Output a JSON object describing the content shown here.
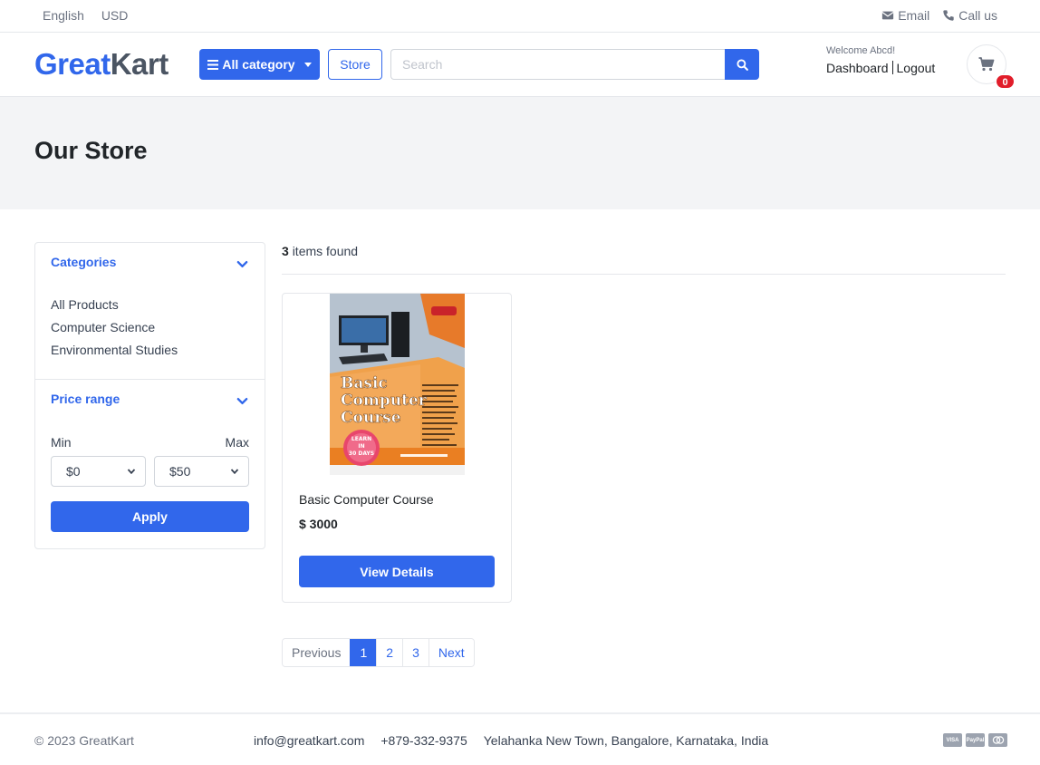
{
  "topbar": {
    "language": "English",
    "currency": "USD",
    "email_label": "Email",
    "call_label": "Call us"
  },
  "header": {
    "logo_part1": "Great",
    "logo_part2": "Kart",
    "category_button": "All category",
    "store_button": "Store",
    "search_placeholder": "Search",
    "welcome_text": "Welcome Abcd!",
    "dashboard_link": "Dashboard",
    "logout_link": "Logout",
    "cart_count": "0"
  },
  "page": {
    "title": "Our Store"
  },
  "sidebar": {
    "categories_title": "Categories",
    "categories": [
      "All Products",
      "Computer Science",
      "Environmental Studies"
    ],
    "price_title": "Price range",
    "min_label": "Min",
    "max_label": "Max",
    "min_value": "$0",
    "max_value": "$50",
    "apply_button": "Apply"
  },
  "results": {
    "count": "3",
    "count_suffix": "items found",
    "products": [
      {
        "name": "Basic Computer Course",
        "price": "$ 3000",
        "button": "View Details",
        "cover_title_lines": [
          "Basic",
          "Computer",
          "Course"
        ],
        "cover_badge_lines": [
          "LEARN",
          "IN",
          "30 DAYS"
        ]
      }
    ]
  },
  "pagination": {
    "previous": "Previous",
    "pages": [
      "1",
      "2",
      "3"
    ],
    "active_page": "1",
    "next": "Next"
  },
  "footer": {
    "copyright": "© 2023 GreatKart",
    "email": "info@greatkart.com",
    "phone": "+879-332-9375",
    "address": "Yelahanka New Town, Bangalore, Karnataka, India",
    "payment_icons": [
      "visa-icon",
      "paypal-icon",
      "mastercard-icon"
    ]
  },
  "colors": {
    "primary": "#3167eb",
    "badge": "#e11d2a",
    "page_header_bg": "#f3f4f6"
  }
}
